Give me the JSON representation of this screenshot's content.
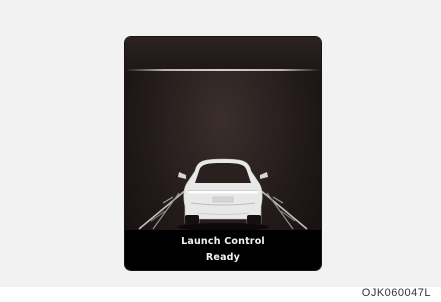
{
  "cluster": {
    "status_line1": "Launch Control",
    "status_line2": "Ready"
  },
  "caption": "OJK060047L",
  "colors": {
    "screen_bg": "#231b1a",
    "status_bar": "#000000",
    "text": "#f2f2f2",
    "car_body": "#e8e8e8"
  },
  "icons": [
    "vehicle-icon",
    "lane-lines-icon"
  ]
}
